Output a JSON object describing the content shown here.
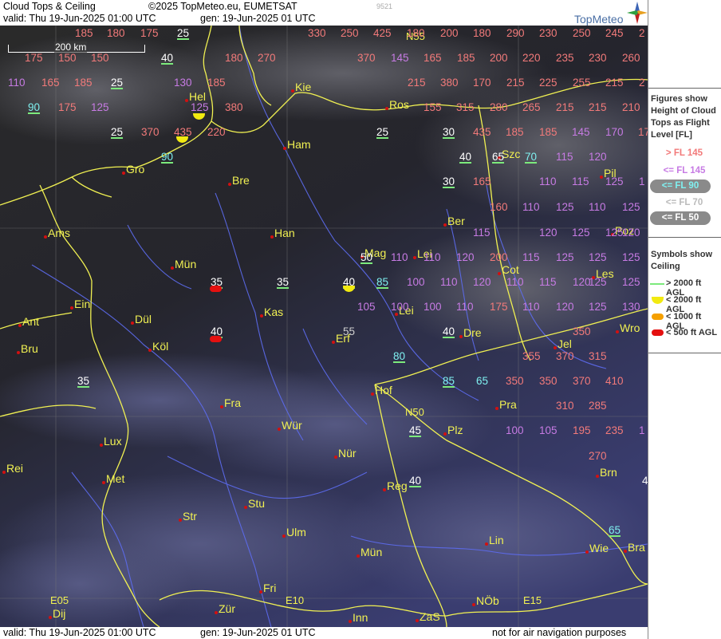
{
  "header": {
    "title": "Cloud Tops & Ceiling",
    "copyright": "©2025 TopMeteo.eu, EUMETSAT",
    "valid": "valid:  Thu  19-Jun-2025  01:00 UTC",
    "gen": "gen: 19-Jun-2025 01 UTC",
    "code": "9521",
    "brand": "TopMeteo"
  },
  "footer": {
    "valid": "valid:  Thu  19-Jun-2025  01:00 UTC",
    "gen": "gen: 19-Jun-2025 01 UTC",
    "disclaimer": "not for air navigation purposes"
  },
  "scale": {
    "label": "200 km"
  },
  "legend": {
    "figures_title": [
      "Figures show",
      "Height of Cloud",
      "Tops as Flight",
      "Level  [FL]"
    ],
    "levels": [
      {
        "label": "> FL 145",
        "color": "#f27a7a"
      },
      {
        "label": "<= FL 145",
        "color": "#c77be4"
      },
      {
        "label": "<= FL 90",
        "color": "#7ff0f0",
        "pill": true
      },
      {
        "label": "<= FL 70",
        "color": "#bbbbbb"
      },
      {
        "label": "<= FL 50",
        "color": "#ffffff",
        "pill": true
      }
    ],
    "symbols_title": [
      "Symbols show",
      "Ceiling"
    ],
    "symbols": [
      {
        "label": "> 2000 ft AGL",
        "kind": "line",
        "color": "#7cea7c"
      },
      {
        "label": "< 2000 ft AGL",
        "kind": "half",
        "color": "#f2ea10"
      },
      {
        "label": "< 1000 ft AGL",
        "kind": "pill",
        "color": "#f5a000"
      },
      {
        "label": "< 500 ft AGL",
        "kind": "pill",
        "color": "#e41010"
      }
    ]
  },
  "grid_labels": [
    "N55",
    "N50",
    "E05",
    "E10",
    "E15"
  ],
  "colors": {
    "high": "#f27a7a",
    "mid": "#c77be4",
    "low": "#7ff0f0",
    "vlow": "#cfcfcf",
    "white": "#ffffff",
    "city": "#f1f152",
    "border": "#f1f152",
    "river": "#5d6cf0"
  },
  "cities": [
    "Kie",
    "Hel",
    "Ros",
    "Ham",
    "Gro",
    "Bre",
    "Szc",
    "Pil",
    "Ams",
    "Han",
    "Ber",
    "Poz",
    "Mag",
    "Lei",
    "Cot",
    "Les",
    "Mün",
    "Ein",
    "Ant",
    "Dül",
    "Kas",
    "Lei",
    "Wro",
    "Bru",
    "Köl",
    "Erf",
    "Dre",
    "Jel",
    "Hof",
    "Fra",
    "Pra",
    "Wür",
    "Plz",
    "Lux",
    "Nür",
    "Rei",
    "Met",
    "Reg",
    "Brn",
    "Stu",
    "Str",
    "Ulm",
    "Lin",
    "Wie",
    "Bra",
    "Mün",
    "Fri",
    "NÖb",
    "Dij",
    "Zür",
    "Inn",
    "ZaS"
  ],
  "cloud_tops": [
    "185",
    "180",
    "175",
    "25",
    "330",
    "250",
    "425",
    "180",
    "200",
    "180",
    "290",
    "230",
    "250",
    "245",
    "2",
    "175",
    "150",
    "150",
    "40",
    "180",
    "270",
    "370",
    "145",
    "165",
    "185",
    "200",
    "220",
    "235",
    "230",
    "260",
    "110",
    "165",
    "185",
    "25",
    "130",
    "185",
    "215",
    "380",
    "170",
    "215",
    "225",
    "255",
    "215",
    "2",
    "90",
    "175",
    "125",
    "125",
    "380",
    "155",
    "315",
    "280",
    "265",
    "215",
    "215",
    "210",
    "25",
    "370",
    "435",
    "220",
    "25",
    "30",
    "435",
    "185",
    "185",
    "145",
    "170",
    "175",
    "90",
    "40",
    "65",
    "70",
    "115",
    "120",
    "30",
    "165",
    "110",
    "115",
    "125",
    "1",
    "160",
    "110",
    "125",
    "110",
    "125",
    "115",
    "120",
    "125",
    "125",
    "120",
    "50",
    "110",
    "110",
    "120",
    "200",
    "115",
    "125",
    "125",
    "125",
    "35",
    "35",
    "40",
    "85",
    "100",
    "110",
    "120",
    "110",
    "115",
    "120",
    "125",
    "125",
    "105",
    "100",
    "100",
    "110",
    "175",
    "110",
    "120",
    "125",
    "130",
    "40",
    "55",
    "40",
    "350",
    "80",
    "355",
    "370",
    "315",
    "35",
    "85",
    "65",
    "350",
    "350",
    "370",
    "410",
    "310",
    "285",
    "45",
    "100",
    "105",
    "195",
    "235",
    "1",
    "270",
    "40",
    "4",
    "65"
  ]
}
